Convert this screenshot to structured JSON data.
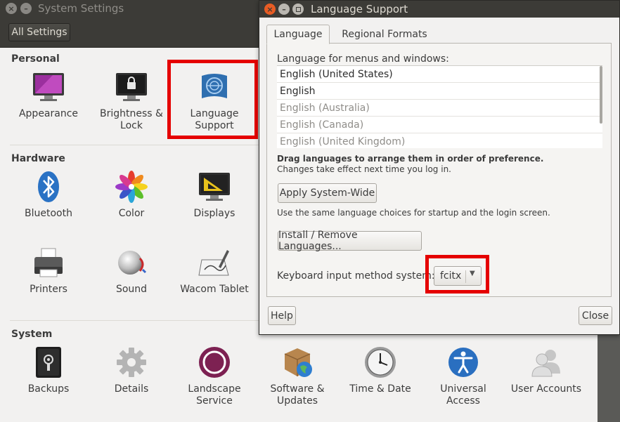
{
  "settings_window": {
    "title": "System Settings",
    "all_settings_label": "All Settings",
    "sections": {
      "personal": {
        "title": "Personal",
        "items": [
          {
            "label": "Appearance",
            "icon": "appearance-icon"
          },
          {
            "label": "Brightness &\nLock",
            "icon": "brightness-lock-icon"
          },
          {
            "label": "Language\nSupport",
            "icon": "language-support-icon"
          }
        ]
      },
      "hardware": {
        "title": "Hardware",
        "items": [
          {
            "label": "Bluetooth",
            "icon": "bluetooth-icon"
          },
          {
            "label": "Color",
            "icon": "color-icon"
          },
          {
            "label": "Displays",
            "icon": "displays-icon"
          },
          {
            "label": "Printers",
            "icon": "printer-icon"
          },
          {
            "label": "Sound",
            "icon": "sound-icon"
          },
          {
            "label": "Wacom Tablet",
            "icon": "wacom-tablet-icon"
          }
        ]
      },
      "system": {
        "title": "System",
        "items": [
          {
            "label": "Backups",
            "icon": "backups-icon"
          },
          {
            "label": "Details",
            "icon": "details-gear-icon"
          },
          {
            "label": "Landscape\nService",
            "icon": "landscape-icon"
          },
          {
            "label": "Software &\nUpdates",
            "icon": "software-updates-icon"
          },
          {
            "label": "Time & Date",
            "icon": "clock-icon"
          },
          {
            "label": "Universal\nAccess",
            "icon": "universal-access-icon"
          },
          {
            "label": "User Accounts",
            "icon": "user-accounts-icon"
          }
        ]
      }
    }
  },
  "language_dialog": {
    "title": "Language Support",
    "tabs": [
      "Language",
      "Regional Formats"
    ],
    "list_label": "Language for menus and windows:",
    "languages": [
      {
        "name": "English (United States)",
        "active": true
      },
      {
        "name": "English",
        "active": true
      },
      {
        "name": "English (Australia)",
        "active": false
      },
      {
        "name": "English (Canada)",
        "active": false
      },
      {
        "name": "English (United Kingdom)",
        "active": false
      }
    ],
    "drag_hint": "Drag languages to arrange them in order of preference.",
    "changes_hint": "Changes take effect next time you log in.",
    "apply_button": "Apply System-Wide",
    "apply_hint": "Use the same language choices for startup and the login screen.",
    "install_button": "Install / Remove Languages...",
    "keyboard_label": "Keyboard input method system:",
    "keyboard_value": "fcitx",
    "help_button": "Help",
    "close_button": "Close"
  },
  "highlight_color": "#e50000"
}
